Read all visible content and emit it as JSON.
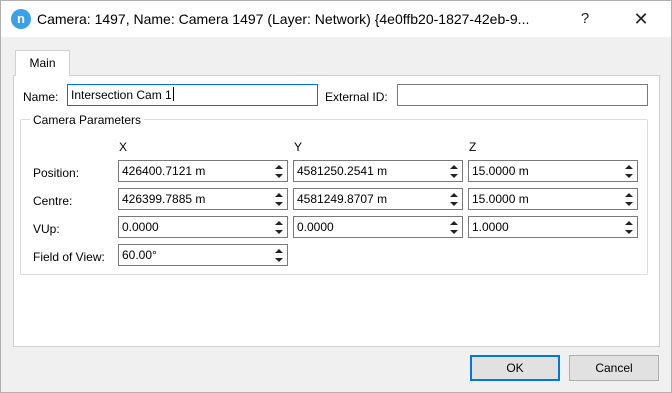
{
  "titlebar": {
    "app_icon_letter": "n",
    "title": "Camera: 1497, Name: Camera 1497 (Layer: Network) {4e0ffb20-1827-42eb-9...",
    "help_label": "?",
    "close_label": "✕"
  },
  "tabs": {
    "main": "Main"
  },
  "name_label": "Name:",
  "name_value": "Intersection Cam 1",
  "external_id_label": "External ID:",
  "external_id_value": "",
  "group": {
    "title": "Camera Parameters",
    "col_x": "X",
    "col_y": "Y",
    "col_z": "Z",
    "position": {
      "label": "Position:",
      "x": "426400.7121 m",
      "y": "4581250.2541 m",
      "z": "15.0000 m"
    },
    "centre": {
      "label": "Centre:",
      "x": "426399.7885 m",
      "y": "4581249.8707 m",
      "z": "15.0000 m"
    },
    "vup": {
      "label": "VUp:",
      "x": "0.0000",
      "y": "0.0000",
      "z": "1.0000"
    },
    "fov": {
      "label": "Field of View:",
      "value": "60.00°"
    }
  },
  "buttons": {
    "ok": "OK",
    "cancel": "Cancel"
  },
  "colors": {
    "accent": "#0078d7",
    "app_icon": "#3aa0e8"
  }
}
